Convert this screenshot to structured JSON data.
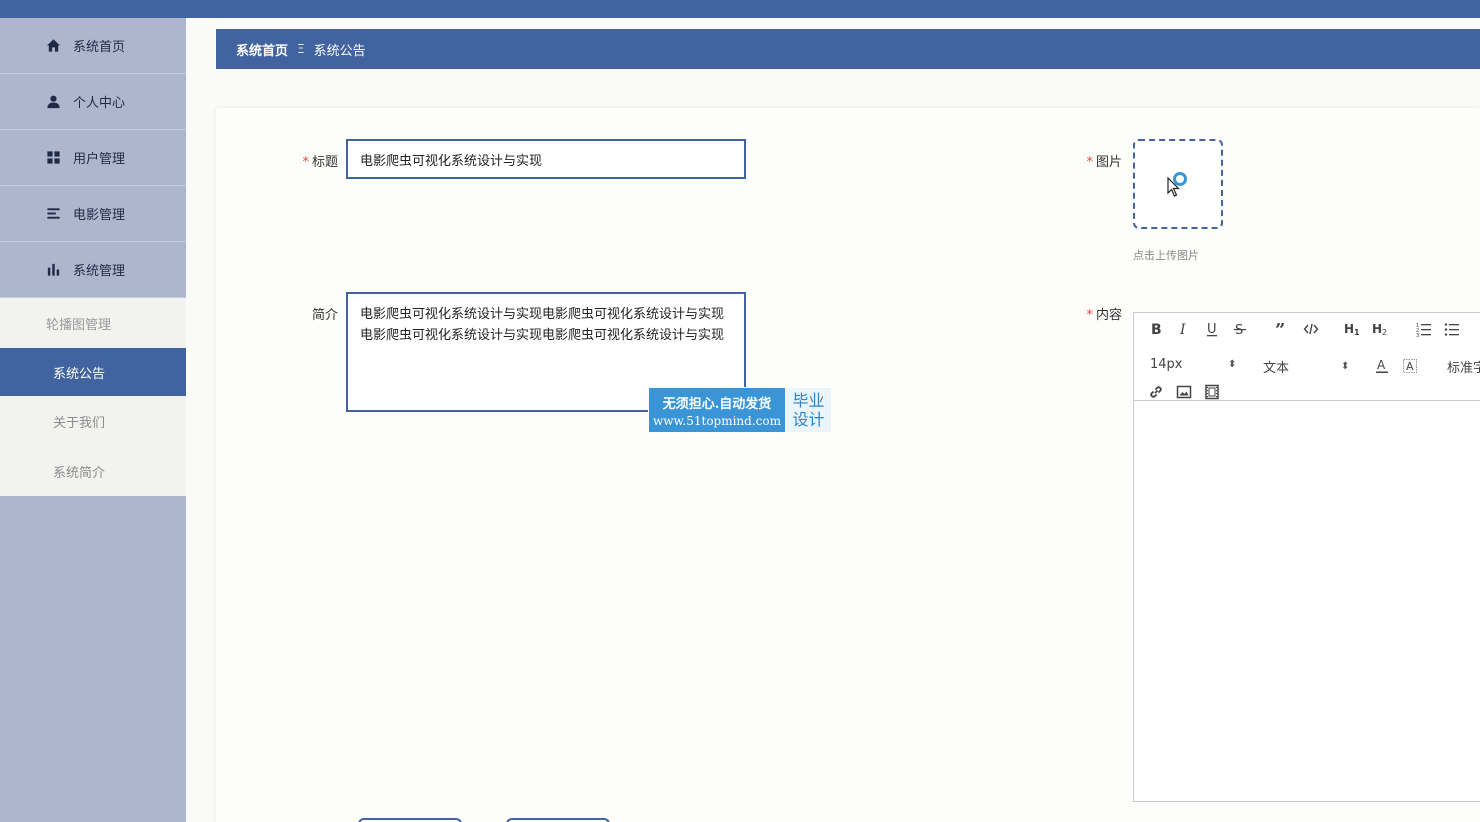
{
  "sidebar": {
    "items": [
      {
        "label": "系统首页",
        "icon": "home-icon"
      },
      {
        "label": "个人中心",
        "icon": "user-icon"
      },
      {
        "label": "用户管理",
        "icon": "grid-icon"
      },
      {
        "label": "电影管理",
        "icon": "list-icon"
      },
      {
        "label": "系统管理",
        "icon": "bar-chart-icon"
      }
    ],
    "subitems": [
      {
        "label": "轮播图管理"
      },
      {
        "label": "系统公告"
      },
      {
        "label": "关于我们"
      },
      {
        "label": "系统简介"
      }
    ]
  },
  "breadcrumb": {
    "home": "系统首页",
    "separator": "Ξ",
    "current": "系统公告"
  },
  "form": {
    "title_label": "标题",
    "title_value": "电影爬虫可视化系统设计与实现",
    "intro_label": "简介",
    "intro_value": "电影爬虫可视化系统设计与实现电影爬虫可视化系统设计与实现电影爬虫可视化系统设计与实现电影爬虫可视化系统设计与实现",
    "image_label": "图片",
    "image_hint": "点击上传图片",
    "content_label": "内容",
    "required_mark": "*"
  },
  "editor": {
    "font_size": "14px",
    "heading": "文本",
    "font_family": "标准字体"
  },
  "watermark": {
    "line1": "无须担心.自动发货",
    "line2": "www.51topmind.com",
    "side1": "毕业",
    "side2": "设计"
  },
  "colors": {
    "primary": "#4163a0",
    "sidebar_bg": "#adb6cd",
    "required": "#e0493c"
  }
}
